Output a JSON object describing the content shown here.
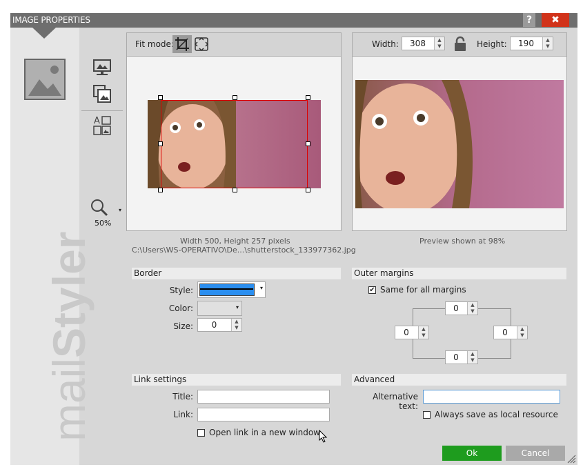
{
  "window": {
    "title": "IMAGE PROPERTIES",
    "help_label": "?",
    "close_label": "✖"
  },
  "brand": {
    "light": "mail",
    "bold": "Styler"
  },
  "zoom": {
    "level": "50%"
  },
  "crop": {
    "fit_mode_label": "Fit mode:"
  },
  "preview": {
    "width_label": "Width:",
    "width_value": "308",
    "height_label": "Height:",
    "height_value": "190",
    "caption": "Preview shown at 98%"
  },
  "image_info": {
    "size_text": "Width  500, Height  257 pixels",
    "path": "C:\\Users\\WS-OPERATIVO\\De...\\shutterstock_133977362.jpg"
  },
  "border": {
    "header": "Border",
    "style_label": "Style:",
    "color_label": "Color:",
    "size_label": "Size:",
    "size_value": "0",
    "style_color": "#2b8ff0"
  },
  "outer_margins": {
    "header": "Outer margins",
    "same_label": "Same for all margins",
    "top": "0",
    "left": "0",
    "right": "0",
    "bottom": "0"
  },
  "link_settings": {
    "header": "Link settings",
    "title_label": "Title:",
    "title_value": "",
    "link_label": "Link:",
    "link_value": "",
    "new_window_label": "Open link in a new window"
  },
  "advanced": {
    "header": "Advanced",
    "alt_label": "Alternative text:",
    "alt_value": "",
    "local_label": "Always save as local resource"
  },
  "buttons": {
    "ok": "Ok",
    "cancel": "Cancel"
  }
}
